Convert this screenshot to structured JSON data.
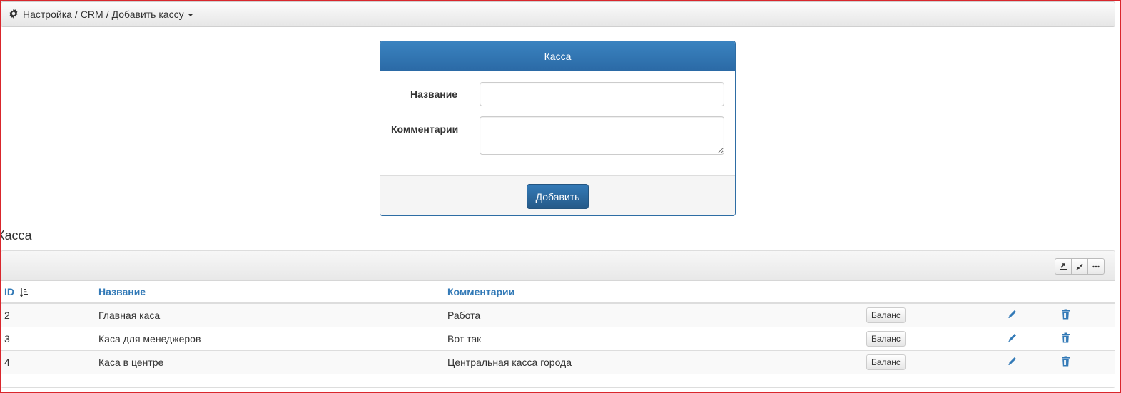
{
  "breadcrumb": {
    "icon": "gear-icon",
    "items": [
      "Настройка",
      "CRM",
      "Добавить кассу"
    ],
    "separator": "/"
  },
  "form": {
    "title": "Касса",
    "name_label": "Название",
    "name_value": "",
    "comment_label": "Комментарии",
    "comment_value": "",
    "submit_label": "Добавить"
  },
  "table_section": {
    "title": "Касса",
    "toolbar_icons": [
      "export-icon",
      "collapse-icon",
      "more-icon"
    ],
    "columns": {
      "id": "ID",
      "name": "Название",
      "comment": "Комментарии"
    },
    "sort": {
      "column": "id",
      "direction": "ascending"
    },
    "rows": [
      {
        "id": "2",
        "name": "Главная каса",
        "comment": "Работа",
        "balance_label": "Баланс"
      },
      {
        "id": "3",
        "name": "Каса для менеджеров",
        "comment": "Вот так",
        "balance_label": "Баланс"
      },
      {
        "id": "4",
        "name": "Каса в центре",
        "comment": "Центральная касса города",
        "balance_label": "Баланс"
      }
    ]
  },
  "colors": {
    "primary": "#337ab7",
    "frame": "#d9262c"
  }
}
